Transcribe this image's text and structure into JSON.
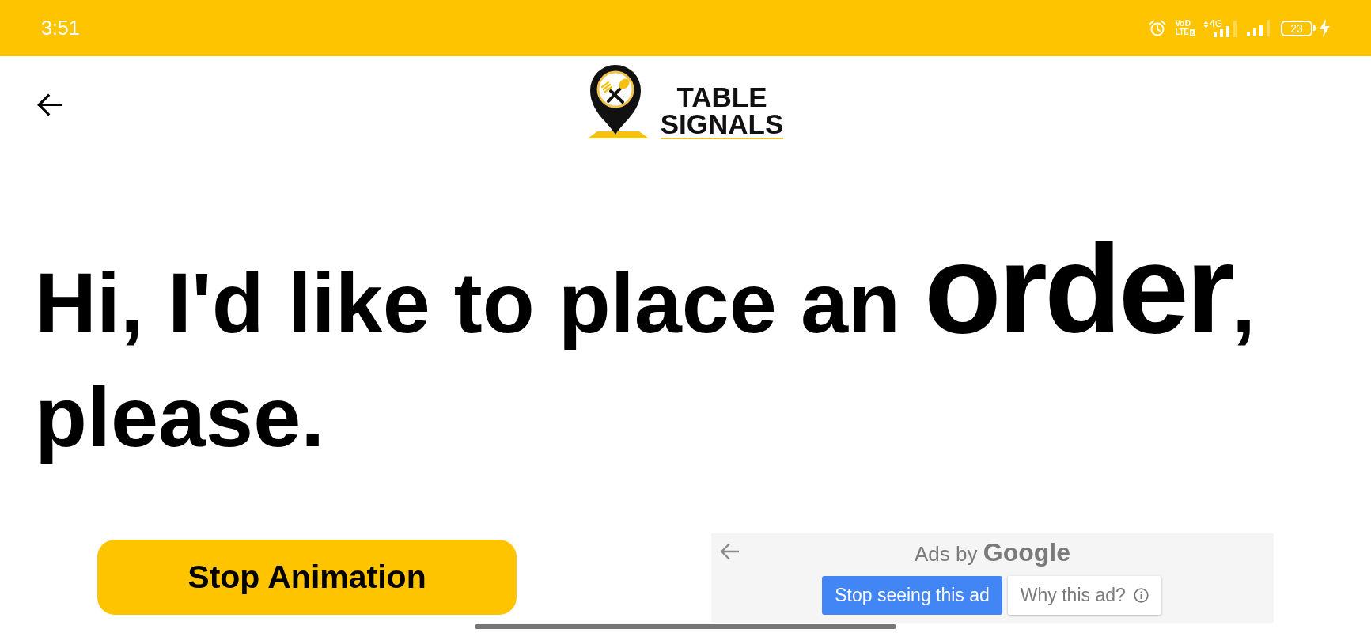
{
  "status_bar": {
    "time": "3:51",
    "volte": {
      "line_1": "Vo",
      "badge_1": "D",
      "line_2": "LTE",
      "badge_2": "2"
    },
    "network_type": "4G",
    "battery": "23",
    "charging": true
  },
  "header": {
    "logo": {
      "line_1": "TABLE",
      "line_2": "SIGNALS"
    }
  },
  "message": "Hi, I'd like to place an **order**, please.",
  "stop_button": {
    "label": "Stop Animation"
  },
  "ad": {
    "title": "Ads by **Google**",
    "buttons": [
      {
        "label": "Stop seeing this ad",
        "kind": "primary"
      },
      {
        "label": "Why this ad?",
        "kind": "info"
      }
    ]
  }
}
